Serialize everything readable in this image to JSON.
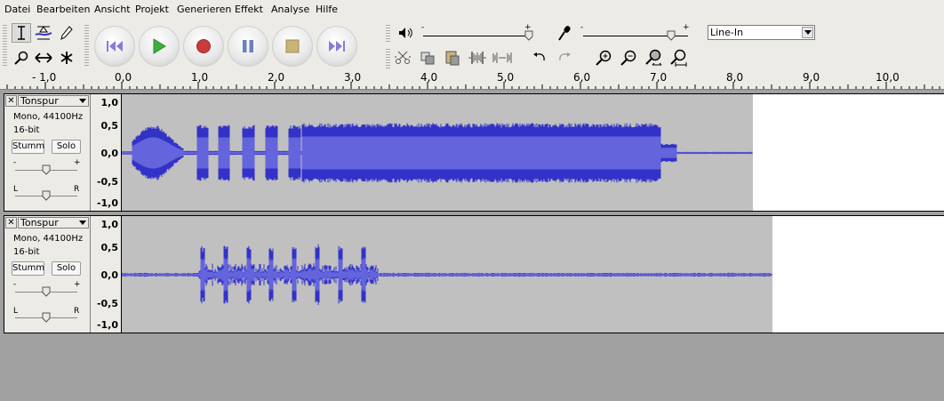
{
  "menu": [
    "Datei",
    "Bearbeiten",
    "Ansicht",
    "Projekt",
    "Generieren",
    "Effekt",
    "Analyse",
    "Hilfe"
  ],
  "meter": {
    "plus": "+",
    "minus": "-"
  },
  "input_source": "Line-In",
  "ruler": {
    "labels": [
      "- 1,0",
      "0,0",
      "1,0",
      "2,0",
      "3,0",
      "4,0",
      "5,0",
      "6,0",
      "7,0",
      "8,0",
      "9,0",
      "10,0"
    ]
  },
  "tracks": [
    {
      "close": "✕",
      "name": "Tonspur",
      "info1": "Mono, 44100Hz",
      "info2": "16-bit",
      "mute": "Stumm",
      "solo": "Solo",
      "gain_minus": "-",
      "gain_plus": "+",
      "pan_l": "L",
      "pan_r": "R",
      "scale": [
        "1,0",
        "0,5",
        "0,0",
        "-0,5",
        "-1,0"
      ],
      "clip_end_seconds": 8.2
    },
    {
      "close": "✕",
      "name": "Tonspur",
      "info1": "Mono, 44100Hz",
      "info2": "16-bit",
      "mute": "Stumm",
      "solo": "Solo",
      "gain_minus": "-",
      "gain_plus": "+",
      "pan_l": "L",
      "pan_r": "R",
      "scale": [
        "1,0",
        "0,5",
        "0,0",
        "-0,5",
        "-1,0"
      ],
      "clip_end_seconds": 8.45
    }
  ],
  "colors": {
    "wave": "#3232c8",
    "wave_rms": "#6464dc",
    "clip_bg": "#c0c0c0",
    "track_bg": "#ffffff"
  }
}
